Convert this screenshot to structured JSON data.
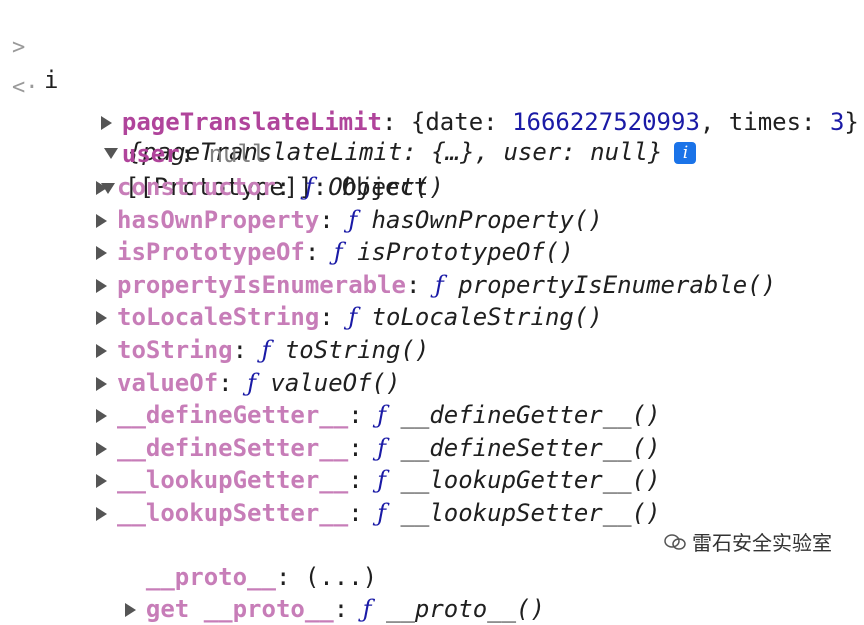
{
  "console": {
    "input_chevron": ">",
    "input_text": "i",
    "output_arrow": "<·",
    "summary": "{pageTranslateLimit: {…}, user: null}",
    "info_icon_text": "i",
    "rows": [
      {
        "key": "pageTranslateLimit",
        "sep": ": ",
        "value": "{date: ",
        "num": "1666227520993",
        "tail": ", times: ",
        "num2": "3",
        "end": "}"
      },
      {
        "key": "user",
        "sep": ": ",
        "value": "null"
      },
      {
        "proto_label": "[[Prototype]]: Object"
      }
    ],
    "proto_members": [
      {
        "key": "constructor",
        "fn": "ƒ",
        "sig": "Object()"
      },
      {
        "key": "hasOwnProperty",
        "fn": "ƒ",
        "sig": "hasOwnProperty()"
      },
      {
        "key": "isPrototypeOf",
        "fn": "ƒ",
        "sig": "isPrototypeOf()"
      },
      {
        "key": "propertyIsEnumerable",
        "fn": "ƒ",
        "sig": "propertyIsEnumerable()"
      },
      {
        "key": "toLocaleString",
        "fn": "ƒ",
        "sig": "toLocaleString()"
      },
      {
        "key": "toString",
        "fn": "ƒ",
        "sig": "toString()"
      },
      {
        "key": "valueOf",
        "fn": "ƒ",
        "sig": "valueOf()"
      },
      {
        "key": "__defineGetter__",
        "fn": "ƒ",
        "sig": "__defineGetter__()"
      },
      {
        "key": "__defineSetter__",
        "fn": "ƒ",
        "sig": "__defineSetter__()"
      },
      {
        "key": "__lookupGetter__",
        "fn": "ƒ",
        "sig": "__lookupGetter__()"
      },
      {
        "key": "__lookupSetter__",
        "fn": "ƒ",
        "sig": "__lookupSetter__()"
      }
    ],
    "proto_accessor": {
      "key": "__proto__",
      "sep": ": ",
      "value": "(...)"
    },
    "get_proto": {
      "key": "get __proto__",
      "fn": "ƒ",
      "sig": "__proto__()"
    }
  },
  "watermark": {
    "text": "雷石安全实验室"
  }
}
